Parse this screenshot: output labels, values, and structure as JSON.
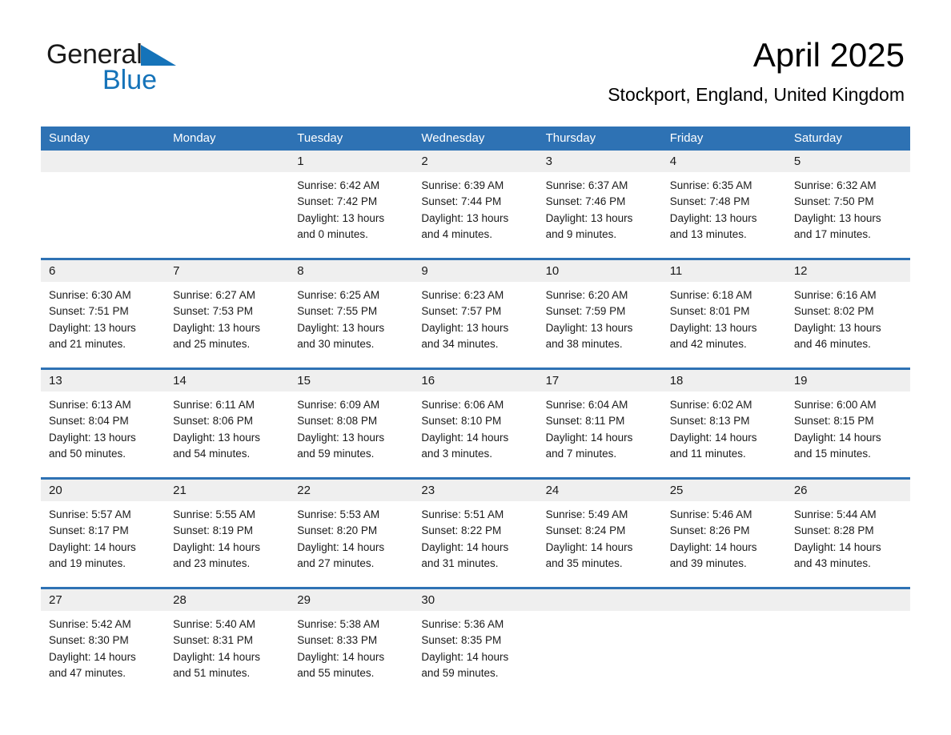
{
  "brand": {
    "name_part1": "General",
    "name_part2": "Blue",
    "triangle_icon": "triangle-icon",
    "accent_color": "#1573b9"
  },
  "header": {
    "title": "April 2025",
    "subtitle": "Stockport, England, United Kingdom",
    "header_bg_color": "#2e72b4",
    "date_band_color": "#efefef"
  },
  "calendar": {
    "weekday_headers": [
      "Sunday",
      "Monday",
      "Tuesday",
      "Wednesday",
      "Thursday",
      "Friday",
      "Saturday"
    ],
    "weeks": [
      {
        "dates": [
          "",
          "",
          "1",
          "2",
          "3",
          "4",
          "5"
        ],
        "cells": [
          {
            "sunrise": "",
            "sunset": "",
            "daylight_line1": "",
            "daylight_line2": ""
          },
          {
            "sunrise": "",
            "sunset": "",
            "daylight_line1": "",
            "daylight_line2": ""
          },
          {
            "sunrise": "Sunrise: 6:42 AM",
            "sunset": "Sunset: 7:42 PM",
            "daylight_line1": "Daylight: 13 hours",
            "daylight_line2": "and 0 minutes."
          },
          {
            "sunrise": "Sunrise: 6:39 AM",
            "sunset": "Sunset: 7:44 PM",
            "daylight_line1": "Daylight: 13 hours",
            "daylight_line2": "and 4 minutes."
          },
          {
            "sunrise": "Sunrise: 6:37 AM",
            "sunset": "Sunset: 7:46 PM",
            "daylight_line1": "Daylight: 13 hours",
            "daylight_line2": "and 9 minutes."
          },
          {
            "sunrise": "Sunrise: 6:35 AM",
            "sunset": "Sunset: 7:48 PM",
            "daylight_line1": "Daylight: 13 hours",
            "daylight_line2": "and 13 minutes."
          },
          {
            "sunrise": "Sunrise: 6:32 AM",
            "sunset": "Sunset: 7:50 PM",
            "daylight_line1": "Daylight: 13 hours",
            "daylight_line2": "and 17 minutes."
          }
        ]
      },
      {
        "dates": [
          "6",
          "7",
          "8",
          "9",
          "10",
          "11",
          "12"
        ],
        "cells": [
          {
            "sunrise": "Sunrise: 6:30 AM",
            "sunset": "Sunset: 7:51 PM",
            "daylight_line1": "Daylight: 13 hours",
            "daylight_line2": "and 21 minutes."
          },
          {
            "sunrise": "Sunrise: 6:27 AM",
            "sunset": "Sunset: 7:53 PM",
            "daylight_line1": "Daylight: 13 hours",
            "daylight_line2": "and 25 minutes."
          },
          {
            "sunrise": "Sunrise: 6:25 AM",
            "sunset": "Sunset: 7:55 PM",
            "daylight_line1": "Daylight: 13 hours",
            "daylight_line2": "and 30 minutes."
          },
          {
            "sunrise": "Sunrise: 6:23 AM",
            "sunset": "Sunset: 7:57 PM",
            "daylight_line1": "Daylight: 13 hours",
            "daylight_line2": "and 34 minutes."
          },
          {
            "sunrise": "Sunrise: 6:20 AM",
            "sunset": "Sunset: 7:59 PM",
            "daylight_line1": "Daylight: 13 hours",
            "daylight_line2": "and 38 minutes."
          },
          {
            "sunrise": "Sunrise: 6:18 AM",
            "sunset": "Sunset: 8:01 PM",
            "daylight_line1": "Daylight: 13 hours",
            "daylight_line2": "and 42 minutes."
          },
          {
            "sunrise": "Sunrise: 6:16 AM",
            "sunset": "Sunset: 8:02 PM",
            "daylight_line1": "Daylight: 13 hours",
            "daylight_line2": "and 46 minutes."
          }
        ]
      },
      {
        "dates": [
          "13",
          "14",
          "15",
          "16",
          "17",
          "18",
          "19"
        ],
        "cells": [
          {
            "sunrise": "Sunrise: 6:13 AM",
            "sunset": "Sunset: 8:04 PM",
            "daylight_line1": "Daylight: 13 hours",
            "daylight_line2": "and 50 minutes."
          },
          {
            "sunrise": "Sunrise: 6:11 AM",
            "sunset": "Sunset: 8:06 PM",
            "daylight_line1": "Daylight: 13 hours",
            "daylight_line2": "and 54 minutes."
          },
          {
            "sunrise": "Sunrise: 6:09 AM",
            "sunset": "Sunset: 8:08 PM",
            "daylight_line1": "Daylight: 13 hours",
            "daylight_line2": "and 59 minutes."
          },
          {
            "sunrise": "Sunrise: 6:06 AM",
            "sunset": "Sunset: 8:10 PM",
            "daylight_line1": "Daylight: 14 hours",
            "daylight_line2": "and 3 minutes."
          },
          {
            "sunrise": "Sunrise: 6:04 AM",
            "sunset": "Sunset: 8:11 PM",
            "daylight_line1": "Daylight: 14 hours",
            "daylight_line2": "and 7 minutes."
          },
          {
            "sunrise": "Sunrise: 6:02 AM",
            "sunset": "Sunset: 8:13 PM",
            "daylight_line1": "Daylight: 14 hours",
            "daylight_line2": "and 11 minutes."
          },
          {
            "sunrise": "Sunrise: 6:00 AM",
            "sunset": "Sunset: 8:15 PM",
            "daylight_line1": "Daylight: 14 hours",
            "daylight_line2": "and 15 minutes."
          }
        ]
      },
      {
        "dates": [
          "20",
          "21",
          "22",
          "23",
          "24",
          "25",
          "26"
        ],
        "cells": [
          {
            "sunrise": "Sunrise: 5:57 AM",
            "sunset": "Sunset: 8:17 PM",
            "daylight_line1": "Daylight: 14 hours",
            "daylight_line2": "and 19 minutes."
          },
          {
            "sunrise": "Sunrise: 5:55 AM",
            "sunset": "Sunset: 8:19 PM",
            "daylight_line1": "Daylight: 14 hours",
            "daylight_line2": "and 23 minutes."
          },
          {
            "sunrise": "Sunrise: 5:53 AM",
            "sunset": "Sunset: 8:20 PM",
            "daylight_line1": "Daylight: 14 hours",
            "daylight_line2": "and 27 minutes."
          },
          {
            "sunrise": "Sunrise: 5:51 AM",
            "sunset": "Sunset: 8:22 PM",
            "daylight_line1": "Daylight: 14 hours",
            "daylight_line2": "and 31 minutes."
          },
          {
            "sunrise": "Sunrise: 5:49 AM",
            "sunset": "Sunset: 8:24 PM",
            "daylight_line1": "Daylight: 14 hours",
            "daylight_line2": "and 35 minutes."
          },
          {
            "sunrise": "Sunrise: 5:46 AM",
            "sunset": "Sunset: 8:26 PM",
            "daylight_line1": "Daylight: 14 hours",
            "daylight_line2": "and 39 minutes."
          },
          {
            "sunrise": "Sunrise: 5:44 AM",
            "sunset": "Sunset: 8:28 PM",
            "daylight_line1": "Daylight: 14 hours",
            "daylight_line2": "and 43 minutes."
          }
        ]
      },
      {
        "dates": [
          "27",
          "28",
          "29",
          "30",
          "",
          "",
          ""
        ],
        "cells": [
          {
            "sunrise": "Sunrise: 5:42 AM",
            "sunset": "Sunset: 8:30 PM",
            "daylight_line1": "Daylight: 14 hours",
            "daylight_line2": "and 47 minutes."
          },
          {
            "sunrise": "Sunrise: 5:40 AM",
            "sunset": "Sunset: 8:31 PM",
            "daylight_line1": "Daylight: 14 hours",
            "daylight_line2": "and 51 minutes."
          },
          {
            "sunrise": "Sunrise: 5:38 AM",
            "sunset": "Sunset: 8:33 PM",
            "daylight_line1": "Daylight: 14 hours",
            "daylight_line2": "and 55 minutes."
          },
          {
            "sunrise": "Sunrise: 5:36 AM",
            "sunset": "Sunset: 8:35 PM",
            "daylight_line1": "Daylight: 14 hours",
            "daylight_line2": "and 59 minutes."
          },
          {
            "sunrise": "",
            "sunset": "",
            "daylight_line1": "",
            "daylight_line2": ""
          },
          {
            "sunrise": "",
            "sunset": "",
            "daylight_line1": "",
            "daylight_line2": ""
          },
          {
            "sunrise": "",
            "sunset": "",
            "daylight_line1": "",
            "daylight_line2": ""
          }
        ]
      }
    ]
  }
}
